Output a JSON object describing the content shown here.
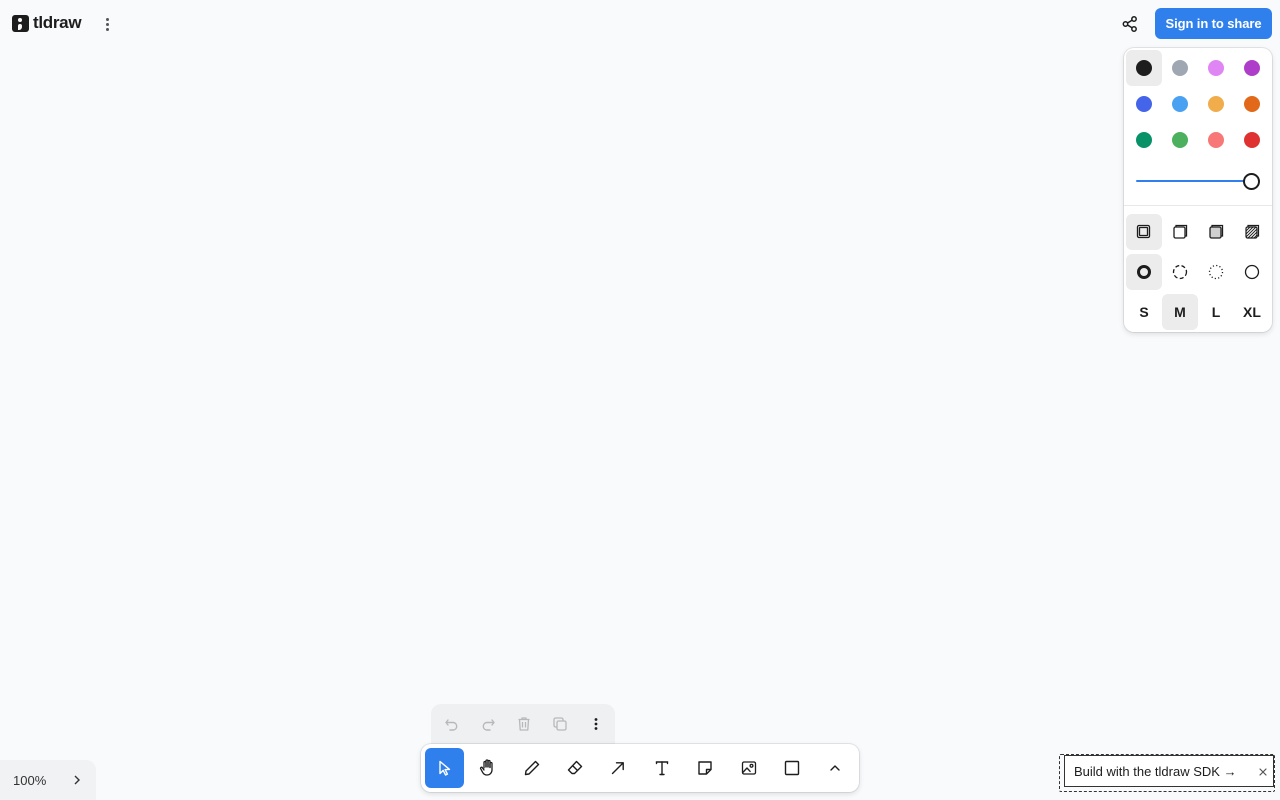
{
  "app": {
    "logo_text": "tldraw"
  },
  "header": {
    "sign_in_label": "Sign in to share"
  },
  "style_panel": {
    "colors": [
      {
        "name": "black",
        "hex": "#1d1d1d",
        "selected": true
      },
      {
        "name": "grey",
        "hex": "#9fa8b2",
        "selected": false
      },
      {
        "name": "light-violet",
        "hex": "#e085f4",
        "selected": false
      },
      {
        "name": "violet",
        "hex": "#ae3ec9",
        "selected": false
      },
      {
        "name": "blue",
        "hex": "#4465e9",
        "selected": false
      },
      {
        "name": "light-blue",
        "hex": "#4ba1f1",
        "selected": false
      },
      {
        "name": "yellow",
        "hex": "#f1ac4b",
        "selected": false
      },
      {
        "name": "orange",
        "hex": "#e16919",
        "selected": false
      },
      {
        "name": "green",
        "hex": "#099268",
        "selected": false
      },
      {
        "name": "light-green",
        "hex": "#4cb05e",
        "selected": false
      },
      {
        "name": "light-red",
        "hex": "#f87777",
        "selected": false
      },
      {
        "name": "red",
        "hex": "#e03131",
        "selected": false
      }
    ],
    "opacity": 1.0,
    "fill_options": [
      "fill-none-icon",
      "fill-semi-icon",
      "fill-solid-icon",
      "fill-pattern-icon"
    ],
    "fill_selected": 0,
    "dash_options": [
      "dash-draw-icon",
      "dash-dashed-icon",
      "dash-dotted-icon",
      "dash-solid-icon"
    ],
    "dash_selected": 0,
    "sizes": [
      "S",
      "M",
      "L",
      "XL"
    ],
    "size_selected": 1
  },
  "zoom": {
    "value": "100%"
  },
  "action_bar": {
    "items": [
      "undo-icon",
      "redo-icon",
      "trash-icon",
      "duplicate-icon",
      "more-icon"
    ]
  },
  "toolbar": {
    "tools": [
      "select",
      "hand",
      "draw",
      "eraser",
      "arrow",
      "text",
      "note",
      "asset",
      "rectangle",
      "more"
    ],
    "active": "select"
  },
  "sdk_banner": {
    "text": "Build with the tldraw SDK →"
  }
}
